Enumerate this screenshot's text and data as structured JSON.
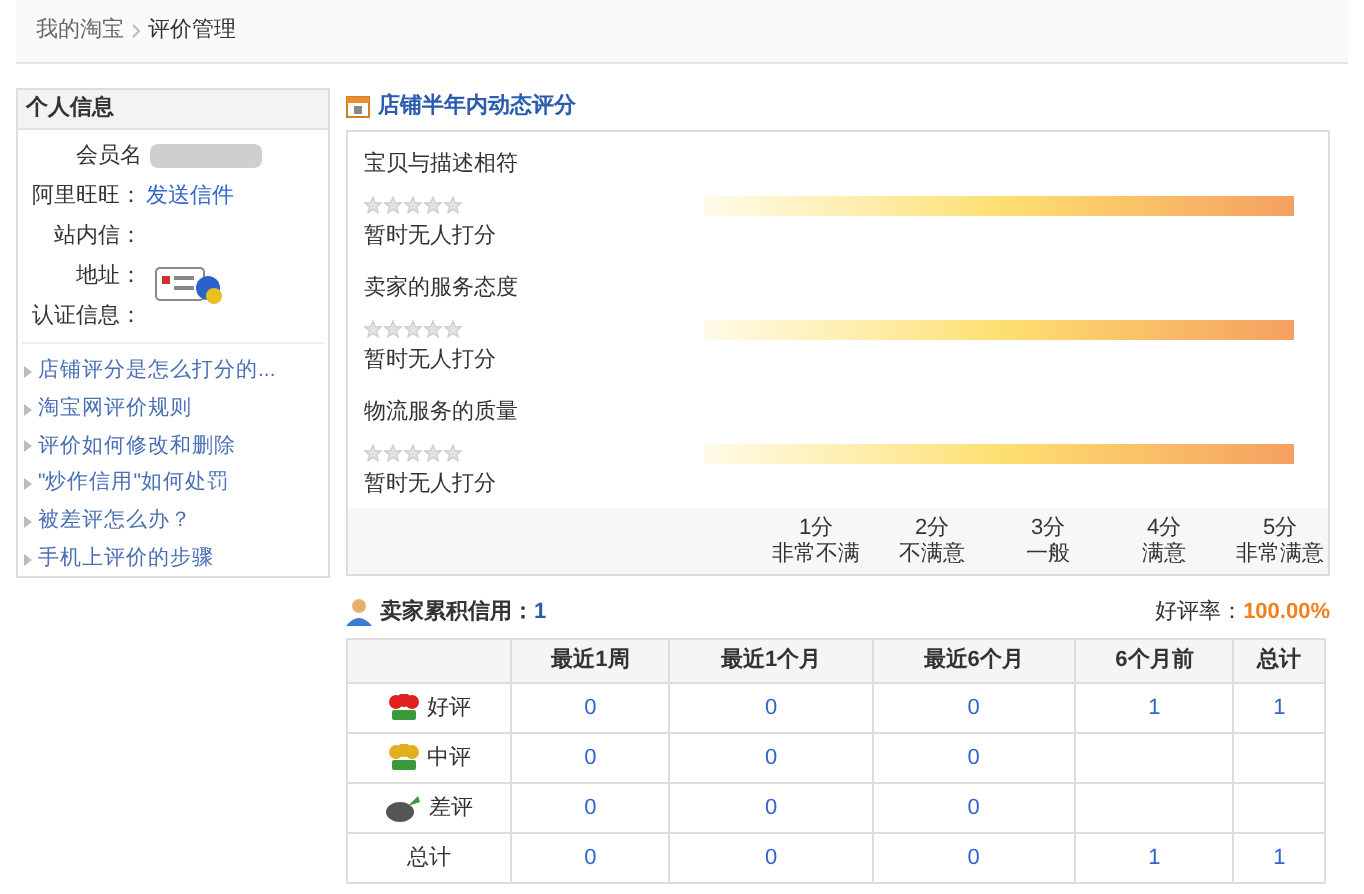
{
  "breadcrumb": [
    "我的淘宝",
    "评价管理"
  ],
  "profile": {
    "title": "个人信息",
    "fields": [
      {
        "label": "会员名",
        "kind": "blurred"
      },
      {
        "label": "阿里旺旺：",
        "kind": "link",
        "value": "发送信件"
      },
      {
        "label": "站内信：",
        "kind": "empty"
      },
      {
        "label": "地址：",
        "kind": "badge"
      },
      {
        "label": "认证信息：",
        "kind": "empty"
      }
    ],
    "links": [
      "店铺评分是怎么打分的...",
      "淘宝网评价规则",
      "评价如何修改和删除",
      "\"炒作信用\"如何处罚",
      "被差评怎么办？",
      "手机上评价的步骤"
    ]
  },
  "ratings": {
    "title": "店铺半年内动态评分",
    "items": [
      {
        "name": "宝贝与描述相符",
        "stars": 0,
        "note": "暂时无人打分"
      },
      {
        "name": "卖家的服务态度",
        "stars": 0,
        "note": "暂时无人打分"
      },
      {
        "name": "物流服务的质量",
        "stars": 0,
        "note": "暂时无人打分"
      }
    ],
    "scale": [
      {
        "score": "1分",
        "label": "非常不满"
      },
      {
        "score": "2分",
        "label": "不满意"
      },
      {
        "score": "3分",
        "label": "一般"
      },
      {
        "score": "4分",
        "label": "满意"
      },
      {
        "score": "5分",
        "label": "非常满意"
      }
    ]
  },
  "credit": {
    "label": "卖家累积信用：",
    "value": "1",
    "rate_label": "好评率：",
    "rate": "100.00%"
  },
  "table": {
    "columns": [
      "最近1周",
      "最近1个月",
      "最近6个月",
      "6个月前",
      "总计"
    ],
    "rows": [
      {
        "kind": "good",
        "label": "好评",
        "cells": [
          "0",
          "0",
          "0",
          "1",
          "1"
        ]
      },
      {
        "kind": "neutral",
        "label": "中评",
        "cells": [
          "0",
          "0",
          "0"
        ]
      },
      {
        "kind": "bad",
        "label": "差评",
        "cells": [
          "0",
          "0",
          "0"
        ]
      },
      {
        "kind": "total",
        "label": "总计",
        "cells": [
          "0",
          "0",
          "0",
          "1",
          "1"
        ]
      }
    ]
  }
}
